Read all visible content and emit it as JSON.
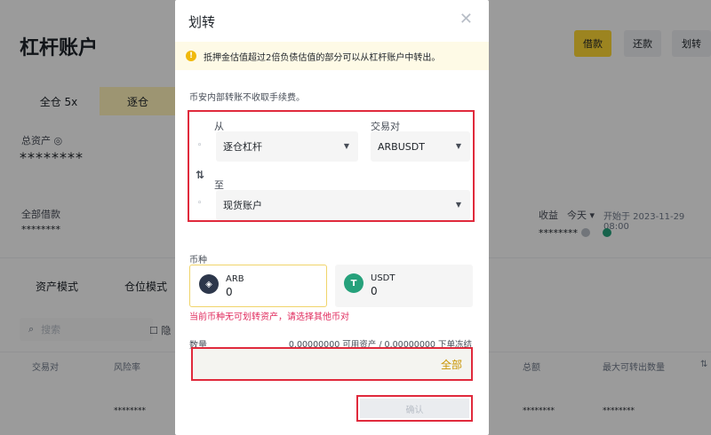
{
  "background": {
    "page_title": "杠杆账户",
    "buttons": {
      "borrow": "借款",
      "repay": "还款",
      "transfer": "划转"
    },
    "margin_tabs": {
      "cross": "全仓 5x",
      "isolated": "逐仓"
    },
    "total_assets_label": "总资产",
    "masked_long": "********",
    "borrowed_label": "全部借款",
    "masked_short": "********",
    "profit_label": "收益",
    "profit_period": "今天",
    "profit_start": "开始于 2023-11-29 08:00",
    "section_tabs": {
      "asset_mode": "资产模式",
      "position_mode": "仓位模式"
    },
    "search_placeholder": "搜索",
    "hide_label": "隐",
    "table_headers": {
      "pair": "交易对",
      "risk": "风险率",
      "total": "总额",
      "max_transferable": "最大可转出数量"
    },
    "row_masked": "********"
  },
  "modal": {
    "title": "划转",
    "notice": "抵押金估值超过2倍负债估值的部分可以从杠杆账户中转出。",
    "fee_note": "币安内部转账不收取手续费。",
    "from_label": "从",
    "pair_label": "交易对",
    "from_account": "逐仓杠杆",
    "pair_value": "ARBUSDT",
    "to_label": "至",
    "to_account": "现货账户",
    "coin_label": "币种",
    "coins": [
      {
        "name": "ARB",
        "value": "0",
        "color": "#2d374b"
      },
      {
        "name": "USDT",
        "value": "0",
        "color": "#26a17b"
      }
    ],
    "error": "当前币种无可划转资产，请选择其他币对",
    "qty_label": "数量",
    "qty_available": "0.00000000 可用资产 / 0.00000000 下单冻结",
    "qty_all": "全部",
    "confirm": "确认"
  },
  "colors": {
    "brand_yellow": "#fcd535",
    "highlight_red": "#e02a3c",
    "error_pink": "#e02a5c"
  }
}
